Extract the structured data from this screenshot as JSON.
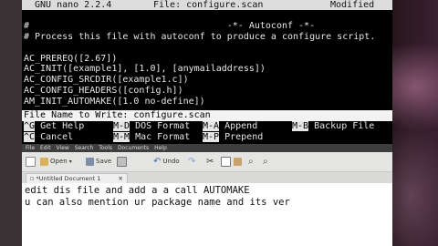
{
  "nano": {
    "version": "GNU nano 2.2.4",
    "file_label": "File: configure.scan",
    "status": "Modified",
    "lines": [
      "#                                    -*- Autoconf -*-",
      "# Process this file with autoconf to produce a configure script.",
      "",
      "AC_PREREQ([2.67])",
      "AC_INIT([example1], [1.0], [anymailaddress])",
      "AC_CONFIG_SRCDIR([example1.c])",
      "AC_CONFIG_HEADERS([config.h])",
      "AM_INIT_AUTOMAKE([1.0 no-define])"
    ],
    "prompt": "File Name to Write: configure.scan",
    "shortcuts": [
      {
        "key": "^G",
        "label": "Get Help"
      },
      {
        "key": "M-D",
        "label": "DOS Format"
      },
      {
        "key": "M-A",
        "label": "Append"
      },
      {
        "key": "M-B",
        "label": "Backup File"
      },
      {
        "key": "^C",
        "label": "Cancel"
      },
      {
        "key": "M-M",
        "label": "Mac Format"
      },
      {
        "key": "M-P",
        "label": "Prepend"
      }
    ]
  },
  "gedit": {
    "menu": [
      "File",
      "Edit",
      "View",
      "Search",
      "Tools",
      "Documents",
      "Help"
    ],
    "toolbar": {
      "open_label": "Open",
      "save_label": "Save",
      "undo_label": "Undo"
    },
    "tab_title": "*Untitled Document 1",
    "text_lines": [
      "edit dis file and add a a call AUTOMAKE",
      "u can also mention ur package name and its ver"
    ]
  }
}
